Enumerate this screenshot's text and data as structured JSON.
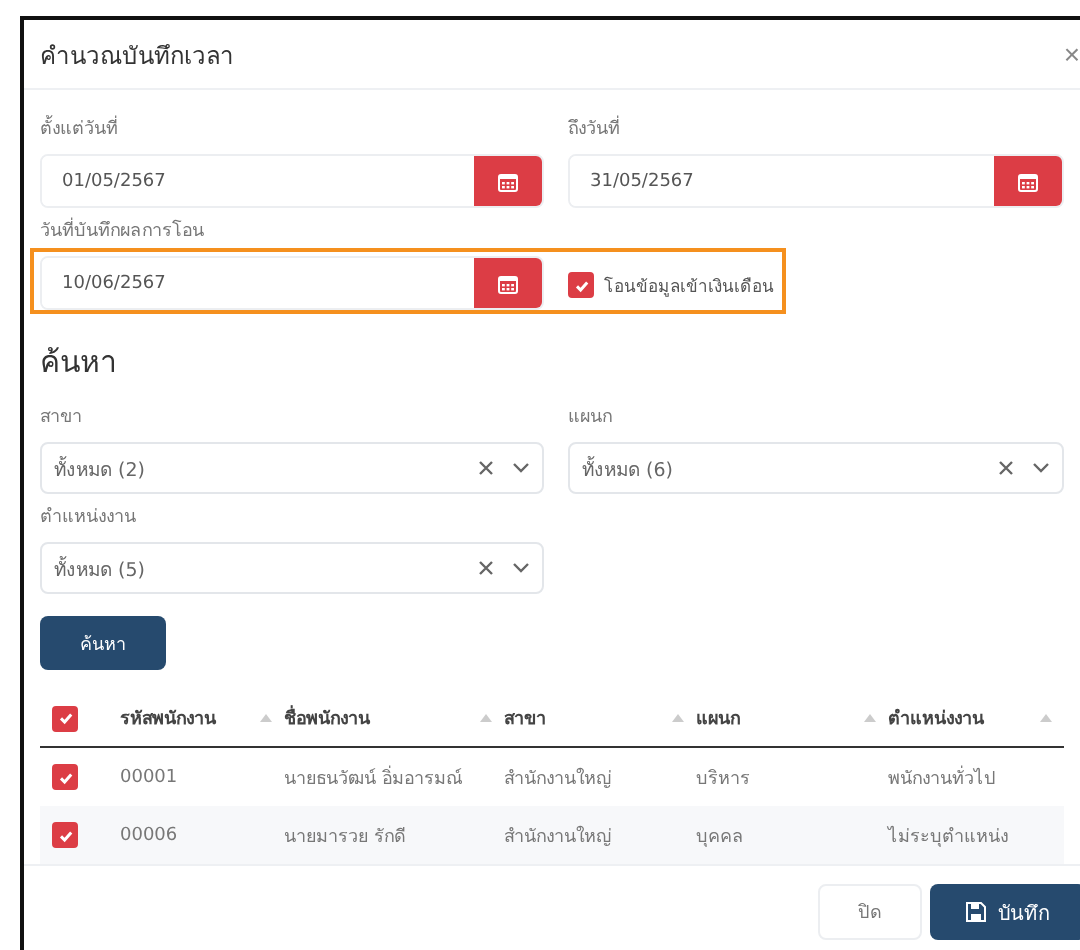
{
  "dialog": {
    "title": "คำนวณบันทึกเวลา",
    "close": "×"
  },
  "date_from": {
    "label": "ตั้งแต่วันที่",
    "value": "01/05/2567"
  },
  "date_to": {
    "label": "ถึงวันที่",
    "value": "31/05/2567"
  },
  "transfer_date": {
    "label": "วันที่บันทึกผลการโอน",
    "value": "10/06/2567"
  },
  "transfer_payroll": {
    "label": "โอนข้อมูลเข้าเงินเดือน",
    "checked": true
  },
  "search": {
    "heading": "ค้นหา",
    "button": "ค้นหา",
    "filters": [
      {
        "label": "สาขา",
        "value": "ทั้งหมด (2)"
      },
      {
        "label": "แผนก",
        "value": "ทั้งหมด (6)"
      },
      {
        "label": "ตำแหน่งงาน",
        "value": "ทั้งหมด (5)"
      }
    ]
  },
  "table": {
    "all_checked": true,
    "columns": [
      "รหัสพนักงาน",
      "ชื่อพนักงาน",
      "สาขา",
      "แผนก",
      "ตำแหน่งงาน"
    ],
    "rows": [
      {
        "selected": true,
        "cells": [
          "00001",
          "นายธนวัฒน์ อิ่มอารมณ์",
          "สำนักงานใหญ่",
          "บริหาร",
          "พนักงานทั่วไป"
        ]
      },
      {
        "selected": true,
        "cells": [
          "00006",
          "นายมารวย รักดี",
          "สำนักงานใหญ่",
          "บุคคล",
          "ไม่ระบุตำแหน่ง"
        ]
      }
    ]
  },
  "footer": {
    "close": "ปิด",
    "save": "บันทึก"
  }
}
